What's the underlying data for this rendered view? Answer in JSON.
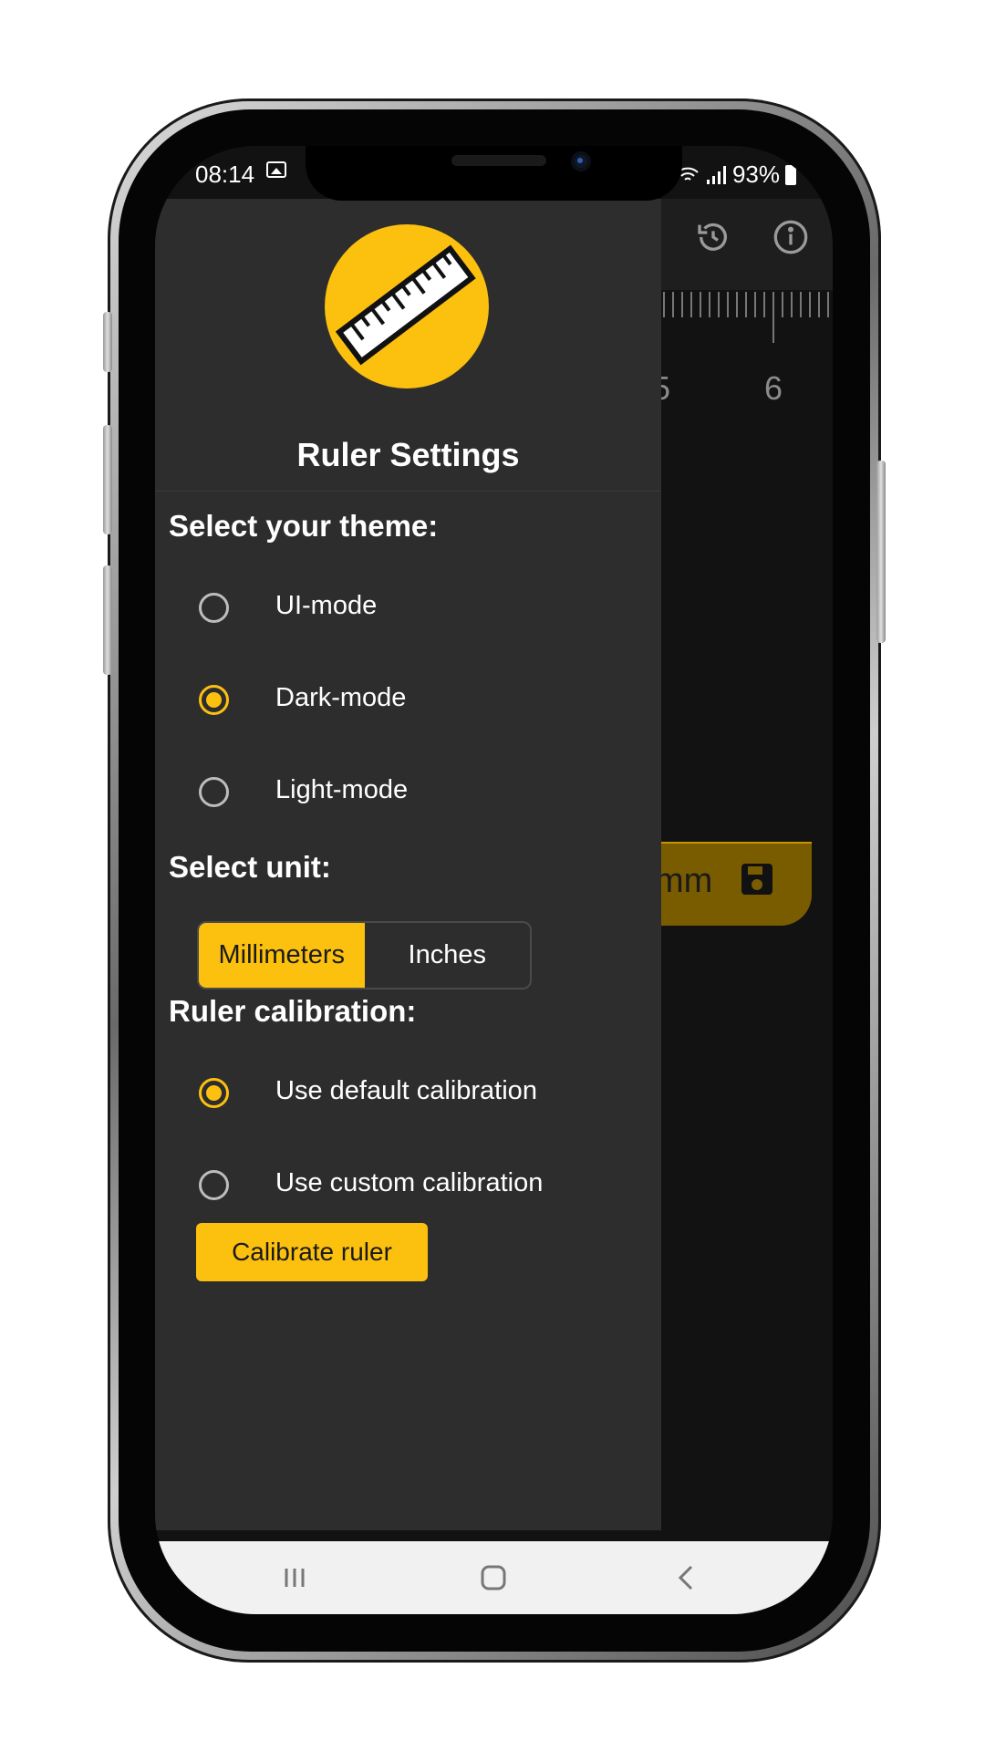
{
  "status_bar": {
    "time": "08:14",
    "battery": "93%"
  },
  "background": {
    "ruler_numbers": [
      "5",
      "6"
    ],
    "save_label": "mm"
  },
  "drawer": {
    "title": "Ruler Settings",
    "theme_label": "Select your theme:",
    "themes": [
      {
        "label": "UI-mode",
        "selected": false
      },
      {
        "label": "Dark-mode",
        "selected": true
      },
      {
        "label": "Light-mode",
        "selected": false
      }
    ],
    "unit_label": "Select unit:",
    "units": {
      "millimeters": "Millimeters",
      "inches": "Inches",
      "selected": "Millimeters"
    },
    "calibration_label": "Ruler calibration:",
    "calibrations": [
      {
        "label": "Use default calibration",
        "selected": true
      },
      {
        "label": "Use custom calibration",
        "selected": false
      }
    ],
    "calibrate_button": "Calibrate ruler"
  },
  "colors": {
    "accent": "#fcc00f",
    "drawer_bg": "#2d2d2d",
    "app_bg": "#121212"
  },
  "icons": [
    "image-icon",
    "wifi-icon",
    "signal-icon",
    "battery-icon",
    "history-icon",
    "info-icon",
    "ruler-icon",
    "save-icon",
    "recents-icon",
    "home-icon",
    "back-icon"
  ]
}
